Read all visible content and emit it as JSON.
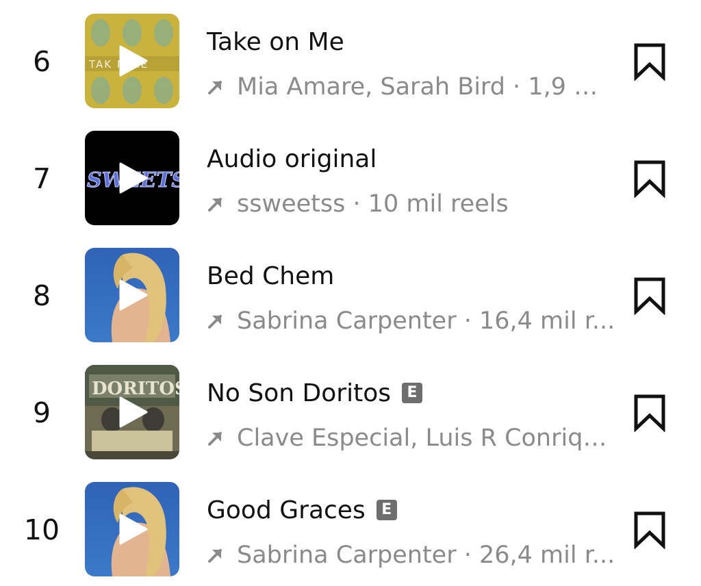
{
  "items": [
    {
      "rank": "6",
      "title": "Take on Me",
      "explicit": false,
      "subtitle": "Mia Amare, Sarah Bird · 1,9 m...",
      "cover_text": "TAK  N ME"
    },
    {
      "rank": "7",
      "title": "Audio original",
      "explicit": false,
      "subtitle": "ssweetss · 10 mil reels",
      "cover_text": "SWEETS"
    },
    {
      "rank": "8",
      "title": "Bed Chem",
      "explicit": false,
      "subtitle": "Sabrina Carpenter · 16,4 mil r..."
    },
    {
      "rank": "9",
      "title": "No Son Doritos",
      "explicit": true,
      "explicit_label": "E",
      "subtitle": "Clave Especial, Luis R Conriqu...",
      "cover_text": "DORITOS"
    },
    {
      "rank": "10",
      "title": "Good Graces",
      "explicit": true,
      "explicit_label": "E",
      "subtitle": "Sabrina Carpenter · 26,4 mil r..."
    }
  ],
  "icons": {
    "play": "play-icon",
    "trend": "arrow-up-right-icon",
    "save": "bookmark-icon"
  },
  "colors": {
    "text": "#111111",
    "subtitle": "#8a8a8a",
    "explicit_badge": "#6e6e6e"
  }
}
